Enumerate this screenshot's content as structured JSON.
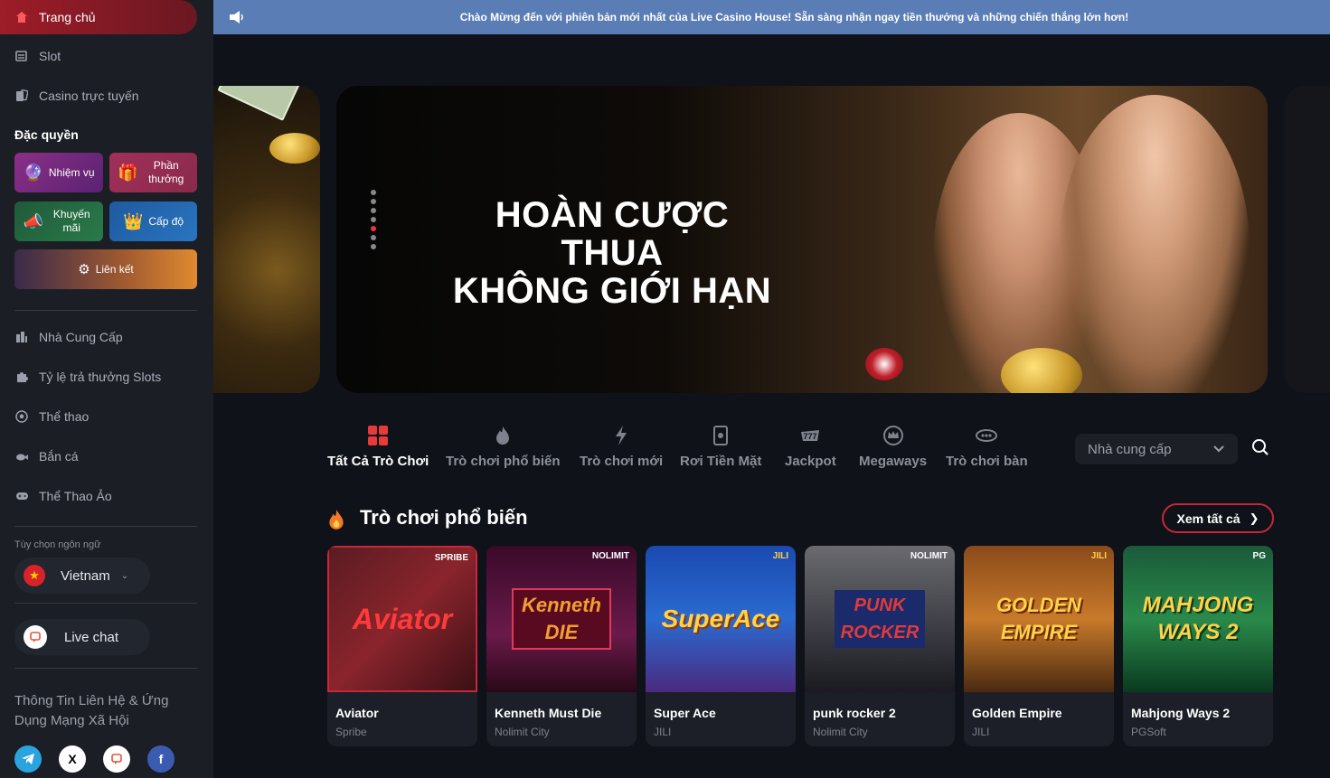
{
  "sidebar": {
    "nav_top": [
      {
        "label": "Trang chủ",
        "icon": "home-icon",
        "active": true
      },
      {
        "label": "Slot",
        "icon": "slot-icon"
      },
      {
        "label": "Casino trực tuyến",
        "icon": "casino-icon"
      }
    ],
    "perks_title": "Đặc quyền",
    "perks": [
      {
        "label": "Nhiệm vụ",
        "icon": "mission-icon"
      },
      {
        "label": "Phần thưởng",
        "icon": "reward-icon"
      },
      {
        "label": "Khuyến mãi",
        "icon": "promotion-icon"
      },
      {
        "label": "Cấp độ",
        "icon": "crown-icon"
      },
      {
        "label": "Liên kết",
        "icon": "affiliate-icon"
      }
    ],
    "nav_bottom": [
      {
        "label": "Nhà Cung Cấp",
        "icon": "provider-icon"
      },
      {
        "label": "Tỷ lệ trả thưởng Slots",
        "icon": "puzzle-icon"
      },
      {
        "label": "Thể thao",
        "icon": "soccer-icon"
      },
      {
        "label": "Bắn cá",
        "icon": "fish-icon"
      },
      {
        "label": "Thể Thao Ảo",
        "icon": "gamepad-icon"
      }
    ],
    "language_label": "Tùy chọn ngôn ngữ",
    "language_value": "Vietnam",
    "live_chat": "Live chat",
    "contact_title": "Thông Tin Liên Hệ & Ứng Dụng Mạng Xã Hội"
  },
  "announcement": "Chào Mừng đến với phiên bản mới nhất của Live Casino House! Sẵn sàng nhận ngay tiền thưởng và những chiến thắng lớn hơn!",
  "hero": {
    "title_line1": "HOÀN CƯỢC THUA",
    "title_line2": "KHÔNG GIỚI HẠN",
    "slide_count": 7,
    "active_slide": 5
  },
  "tabs": [
    {
      "label": "Tất Cả Trò Chơi",
      "icon": "grid-icon",
      "active": true
    },
    {
      "label": "Trò chơi phổ biến",
      "icon": "fire-icon"
    },
    {
      "label": "Trò chơi mới",
      "icon": "bolt-icon"
    },
    {
      "label": "Rơi Tiền Mặt",
      "icon": "cash-drop-icon"
    },
    {
      "label": "Jackpot",
      "icon": "jackpot-icon"
    },
    {
      "label": "Megaways",
      "icon": "megaways-icon"
    },
    {
      "label": "Trò chơi bàn",
      "icon": "table-game-icon"
    }
  ],
  "provider_select": {
    "placeholder": "Nhà cung cấp"
  },
  "popular": {
    "title": "Trò chơi phổ biến",
    "see_all": "Xem tất cả",
    "games": [
      {
        "name": "Aviator",
        "provider": "Spribe",
        "badge": "SPRIBE",
        "art": "Aviator"
      },
      {
        "name": "Kenneth Must Die",
        "provider": "Nolimit City",
        "badge": "NOLIMIT",
        "art": "Kenneth DIE"
      },
      {
        "name": "Super Ace",
        "provider": "JILI",
        "badge": "JILI",
        "art": "SuperAce"
      },
      {
        "name": "punk rocker 2",
        "provider": "Nolimit City",
        "badge": "NOLIMIT",
        "art": "PUNK ROCKER"
      },
      {
        "name": "Golden Empire",
        "provider": "JILI",
        "badge": "JILI",
        "art": "GOLDEN EMPIRE"
      },
      {
        "name": "Mahjong Ways 2",
        "provider": "PGSoft",
        "badge": "PG",
        "art": "MAHJONG WAYS 2"
      }
    ]
  },
  "colors": {
    "accent_red": "#c8263a",
    "topbar_blue": "#5a7db6",
    "sidebar_bg": "#1b1e25",
    "page_bg": "#0f1218"
  }
}
